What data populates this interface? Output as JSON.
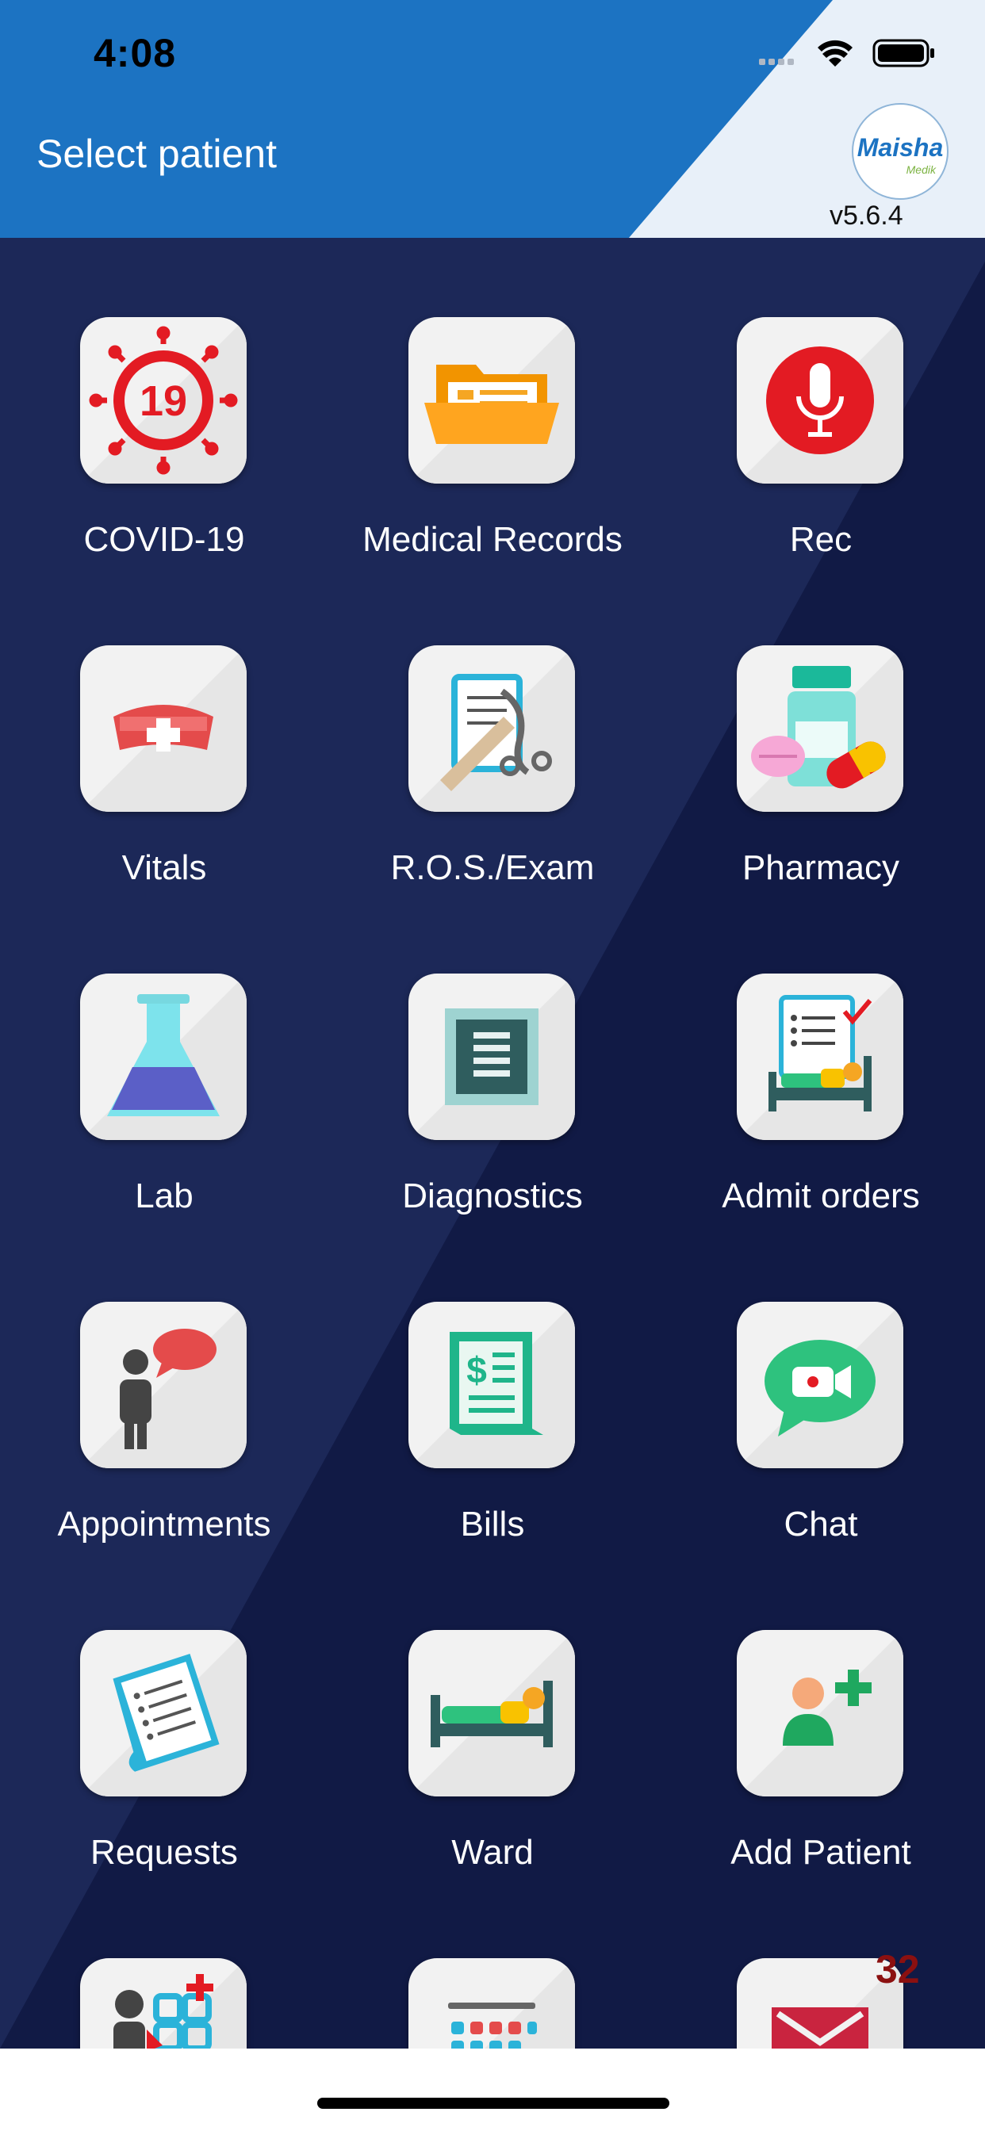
{
  "status_bar": {
    "time": "4:08"
  },
  "header": {
    "title": "Select patient",
    "version": "v5.6.4"
  },
  "logo": {
    "name": "Maisha",
    "sub": "Medik"
  },
  "tiles": [
    {
      "label": "COVID-19",
      "icon": "covid-19-icon"
    },
    {
      "label": "Medical Records",
      "icon": "folder-icon"
    },
    {
      "label": "Rec",
      "icon": "microphone-icon"
    },
    {
      "label": "Vitals",
      "icon": "nurse-cap-icon"
    },
    {
      "label": "R.O.S./Exam",
      "icon": "stethoscope-clipboard-icon"
    },
    {
      "label": "Pharmacy",
      "icon": "pills-bottle-icon"
    },
    {
      "label": "Lab",
      "icon": "flask-icon"
    },
    {
      "label": "Diagnostics",
      "icon": "document-icon"
    },
    {
      "label": "Admit orders",
      "icon": "hospital-bed-checklist-icon"
    },
    {
      "label": "Appointments",
      "icon": "person-speech-icon"
    },
    {
      "label": "Bills",
      "icon": "dollar-receipt-icon"
    },
    {
      "label": "Chat",
      "icon": "video-chat-icon"
    },
    {
      "label": "Requests",
      "icon": "request-list-icon"
    },
    {
      "label": "Ward",
      "icon": "ward-bed-icon"
    },
    {
      "label": "Add Patient",
      "icon": "add-person-icon"
    },
    {
      "label": "",
      "icon": "people-grid-icon"
    },
    {
      "label": "",
      "icon": "calendar-icon"
    },
    {
      "label": "",
      "icon": "mail-icon"
    }
  ],
  "badge": "32",
  "colors": {
    "header_blue": "#1c73c2",
    "background_navy": "#111a45",
    "accent_red": "#e31b23"
  }
}
